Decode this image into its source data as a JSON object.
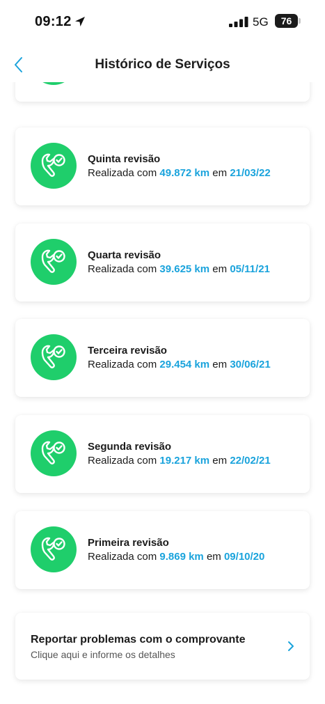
{
  "status_bar": {
    "time": "09:12",
    "network": "5G",
    "battery": "76",
    "icons": [
      "location-arrow-icon",
      "signal-bars-icon",
      "battery-icon"
    ]
  },
  "nav": {
    "back_icon": "chevron-left-icon",
    "title": "Histórico de Serviços"
  },
  "colors": {
    "accent": "#1aa3dc",
    "icon_bg": "#1fce6b",
    "text": "#1b1b1b"
  },
  "services": [
    {
      "title": "",
      "prefix": "",
      "km": "",
      "connector": "",
      "date": "",
      "icon": "wrench-check-icon"
    },
    {
      "title": "Quinta revisão",
      "prefix": "Realizada com ",
      "km": "49.872 km",
      "connector": " em ",
      "date": "21/03/22",
      "icon": "wrench-check-icon"
    },
    {
      "title": "Quarta revisão",
      "prefix": "Realizada com ",
      "km": "39.625 km",
      "connector": " em ",
      "date": "05/11/21",
      "icon": "wrench-check-icon"
    },
    {
      "title": "Terceira revisão",
      "prefix": "Realizada com ",
      "km": "29.454 km",
      "connector": " em ",
      "date": "30/06/21",
      "icon": "wrench-check-icon"
    },
    {
      "title": "Segunda revisão",
      "prefix": "Realizada com ",
      "km": "19.217 km",
      "connector": " em ",
      "date": "22/02/21",
      "icon": "wrench-check-icon"
    },
    {
      "title": "Primeira revisão",
      "prefix": "Realizada com ",
      "km": "9.869 km",
      "connector": " em ",
      "date": "09/10/20",
      "icon": "wrench-check-icon"
    }
  ],
  "report": {
    "title": "Reportar problemas com o comprovante",
    "subtitle": "Clique aqui e informe os detalhes",
    "icon": "chevron-right-icon"
  }
}
